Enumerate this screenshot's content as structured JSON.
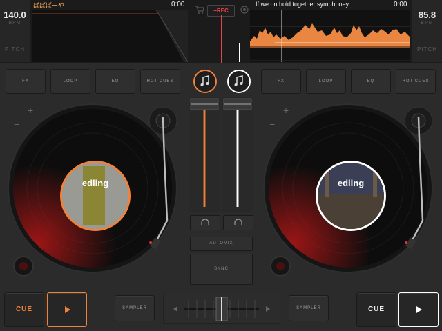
{
  "left_deck": {
    "bpm": "140.0",
    "bpm_label": "BPM",
    "pitch_label": "PITCH",
    "track_title": "ぱぱぱーや",
    "time": "0:00",
    "accent": "#f0823c",
    "buttons": [
      "FX",
      "LOOP",
      "EQ",
      "HOT CUES"
    ],
    "cue_label": "CUE",
    "play_icon": "play-icon",
    "label_logo": "edling"
  },
  "right_deck": {
    "bpm": "85.8",
    "bpm_label": "BPM",
    "pitch_label": "PITCH",
    "track_title": "If we on hold together symphoney",
    "time": "0:00",
    "accent": "#ffffff",
    "buttons": [
      "FX",
      "LOOP",
      "EQ",
      "HOT CUES"
    ],
    "cue_label": "CUE",
    "play_icon": "play-icon",
    "label_logo": "edling"
  },
  "header": {
    "rec_label": "+REC",
    "cart_icon": "cart-icon",
    "settings_icon": "gear-icon"
  },
  "mixer": {
    "automix_label": "AUTOMIX",
    "sync_label": "SYNC",
    "sampler_left": "SAMPLER",
    "sampler_right": "SAMPLER",
    "left_volume": 0.85,
    "right_volume": 0.85
  },
  "colors": {
    "accent_orange": "#f0823c",
    "rec_red": "#e84343",
    "background": "#2b2b2b"
  }
}
